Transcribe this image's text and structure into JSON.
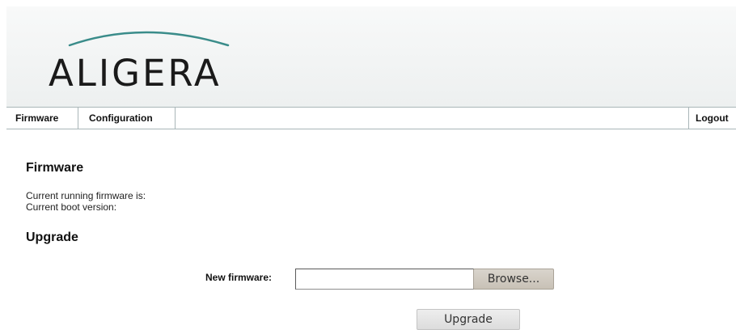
{
  "brand": {
    "logo_text": "ALIGERA",
    "arc_color": "#3a8c8a"
  },
  "nav": {
    "items": [
      {
        "label": "Firmware"
      },
      {
        "label": "Configuration"
      }
    ],
    "logout_label": "Logout"
  },
  "firmware_section": {
    "heading": "Firmware",
    "running_label": "Current running firmware is:",
    "boot_label": "Current boot version:"
  },
  "upgrade_section": {
    "heading": "Upgrade",
    "new_firmware_label": "New firmware:",
    "file_value": "",
    "browse_label": "Browse...",
    "upgrade_label": "Upgrade"
  }
}
